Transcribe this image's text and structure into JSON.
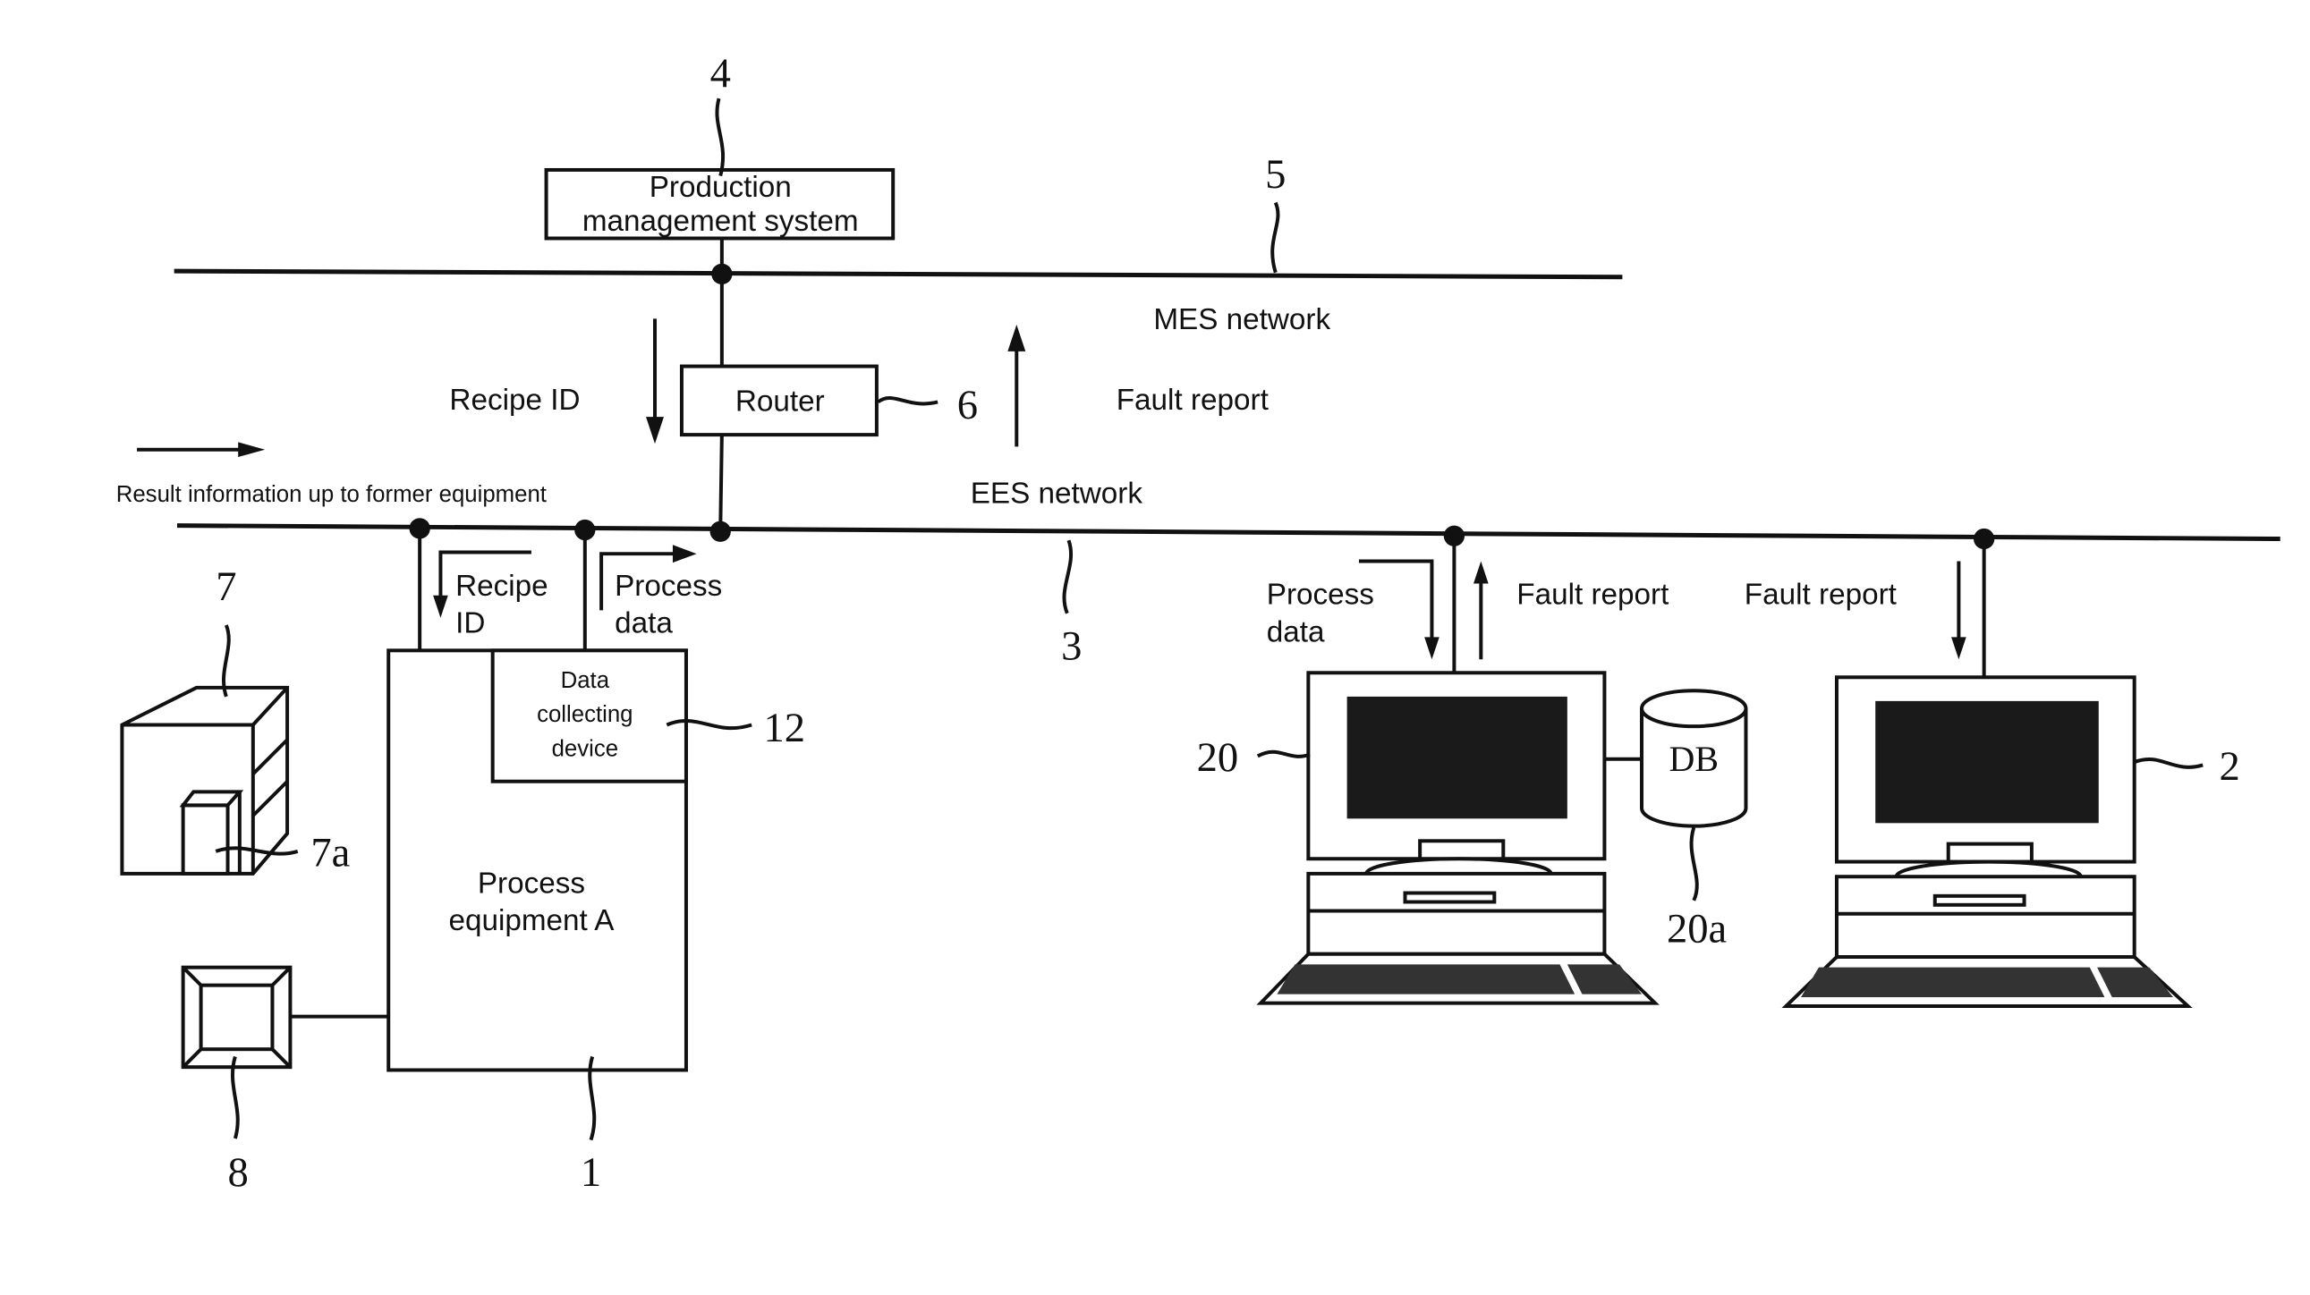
{
  "diagram": {
    "networks": {
      "mes": {
        "label": "MES network",
        "ref": "5"
      },
      "ees": {
        "label": "EES network",
        "ref": "3"
      }
    },
    "nodes": {
      "production_management": {
        "label_line1": "Production",
        "label_line2": "management system",
        "ref": "4"
      },
      "router": {
        "label": "Router",
        "ref": "6"
      },
      "process_equipment": {
        "label_line1": "Process",
        "label_line2": "equipment A",
        "ref": "1"
      },
      "data_collecting": {
        "label_line1": "Data",
        "label_line2": "collecting",
        "label_line3": "device",
        "ref": "12"
      },
      "storage_unit": {
        "ref": "7",
        "sub_ref": "7a"
      },
      "terminal": {
        "ref": "8"
      },
      "computer_left": {
        "ref": "20"
      },
      "database": {
        "label": "DB",
        "ref": "20a"
      },
      "computer_right": {
        "ref": "2"
      }
    },
    "flows": {
      "recipe_id_top": "Recipe ID",
      "fault_report_top": "Fault report",
      "result_info": "Result information up to former equipment",
      "recipe_id_line1": "Recipe",
      "recipe_id_line2": "ID",
      "process_data_line1": "Process",
      "process_data_line2": "data",
      "pc_process_data_line1": "Process",
      "pc_process_data_line2": "data",
      "pc_fault_report": "Fault report",
      "pc2_fault_report": "Fault report"
    }
  }
}
